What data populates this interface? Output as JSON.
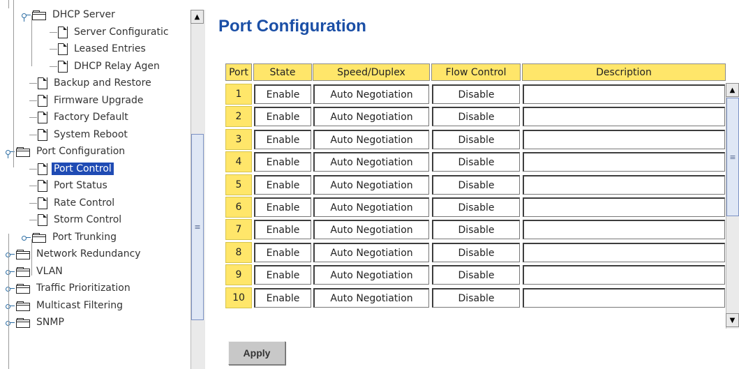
{
  "tree": {
    "items": [
      {
        "label": "DHCP Server",
        "kind": "folder",
        "level": 1,
        "handle": "expanded"
      },
      {
        "label": "Server Configuratic",
        "kind": "page",
        "level": 2
      },
      {
        "label": "Leased Entries",
        "kind": "page",
        "level": 2
      },
      {
        "label": "DHCP Relay Agen",
        "kind": "page",
        "level": 2
      },
      {
        "label": "Backup and Restore",
        "kind": "page",
        "level": 1
      },
      {
        "label": "Firmware Upgrade",
        "kind": "page",
        "level": 1
      },
      {
        "label": "Factory Default",
        "kind": "page",
        "level": 1
      },
      {
        "label": "System Reboot",
        "kind": "page",
        "level": 1
      },
      {
        "label": "Port Configuration",
        "kind": "folder",
        "level": 0,
        "handle": "expanded"
      },
      {
        "label": "Port Control",
        "kind": "page",
        "level": 1,
        "selected": true
      },
      {
        "label": "Port Status",
        "kind": "page",
        "level": 1
      },
      {
        "label": "Rate Control",
        "kind": "page",
        "level": 1
      },
      {
        "label": "Storm Control",
        "kind": "page",
        "level": 1
      },
      {
        "label": "Port Trunking",
        "kind": "folder",
        "level": 1,
        "handle": "collapsed"
      },
      {
        "label": "Network Redundancy",
        "kind": "folder",
        "level": 0,
        "handle": "collapsed"
      },
      {
        "label": "VLAN",
        "kind": "folder",
        "level": 0,
        "handle": "collapsed"
      },
      {
        "label": "Traffic Prioritization",
        "kind": "folder",
        "level": 0,
        "handle": "collapsed"
      },
      {
        "label": "Multicast Filtering",
        "kind": "folder",
        "level": 0,
        "handle": "collapsed"
      },
      {
        "label": "SNMP",
        "kind": "folder",
        "level": 0,
        "handle": "collapsed"
      }
    ]
  },
  "main": {
    "title": "Port Configuration",
    "table": {
      "headers": {
        "port": "Port",
        "state": "State",
        "speed": "Speed/Duplex",
        "flow": "Flow Control",
        "description": "Description"
      },
      "rows": [
        {
          "port": "1",
          "state": "Enable",
          "speed": "Auto Negotiation",
          "flow": "Disable",
          "description": ""
        },
        {
          "port": "2",
          "state": "Enable",
          "speed": "Auto Negotiation",
          "flow": "Disable",
          "description": ""
        },
        {
          "port": "3",
          "state": "Enable",
          "speed": "Auto Negotiation",
          "flow": "Disable",
          "description": ""
        },
        {
          "port": "4",
          "state": "Enable",
          "speed": "Auto Negotiation",
          "flow": "Disable",
          "description": ""
        },
        {
          "port": "5",
          "state": "Enable",
          "speed": "Auto Negotiation",
          "flow": "Disable",
          "description": ""
        },
        {
          "port": "6",
          "state": "Enable",
          "speed": "Auto Negotiation",
          "flow": "Disable",
          "description": ""
        },
        {
          "port": "7",
          "state": "Enable",
          "speed": "Auto Negotiation",
          "flow": "Disable",
          "description": ""
        },
        {
          "port": "8",
          "state": "Enable",
          "speed": "Auto Negotiation",
          "flow": "Disable",
          "description": ""
        },
        {
          "port": "9",
          "state": "Enable",
          "speed": "Auto Negotiation",
          "flow": "Disable",
          "description": ""
        },
        {
          "port": "10",
          "state": "Enable",
          "speed": "Auto Negotiation",
          "flow": "Disable",
          "description": ""
        }
      ]
    },
    "apply_label": "Apply"
  },
  "colors": {
    "title": "#1b4fa6",
    "header_bg": "#ffe66a",
    "selected_bg": "#1f4bb4"
  },
  "icons": {
    "folder": "folder-icon",
    "page": "page-icon",
    "scroll_up": "arrow-up-icon",
    "scroll_down": "arrow-down-icon"
  }
}
